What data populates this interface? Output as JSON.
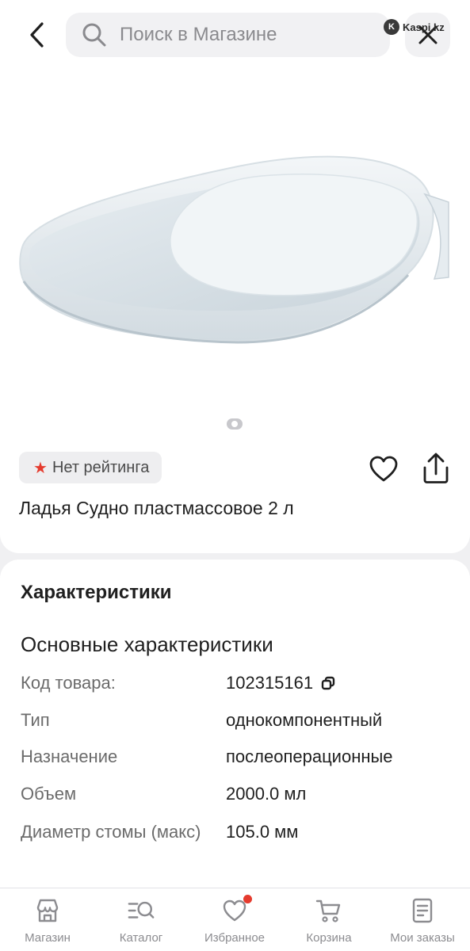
{
  "header": {
    "search_placeholder": "Поиск в Магазине",
    "watermark_text": "Kaspi.kz"
  },
  "product": {
    "image_alt": "white plastic bedpan",
    "gallery_count": 1,
    "rating_text": "Нет рейтинга",
    "title": "Ладья Судно пластмассовое 2 л"
  },
  "specs": {
    "heading": "Характеристики",
    "group_title": "Основные характеристики",
    "rows": [
      {
        "label": "Код товара:",
        "value": "102315161"
      },
      {
        "label": "Тип",
        "value": "однокомпонентный"
      },
      {
        "label": "Назначение",
        "value": "послеоперационные"
      },
      {
        "label": "Объем",
        "value": "2000.0 мл"
      },
      {
        "label": "Диаметр стомы (макс)",
        "value": "105.0 мм"
      }
    ]
  },
  "nav": {
    "items": [
      {
        "label": "Магазин",
        "icon": "store-icon"
      },
      {
        "label": "Каталог",
        "icon": "catalog-search-icon"
      },
      {
        "label": "Избранное",
        "icon": "heart-icon"
      },
      {
        "label": "Корзина",
        "icon": "cart-icon"
      },
      {
        "label": "Мои заказы",
        "icon": "orders-icon"
      }
    ]
  },
  "colors": {
    "accent_red": "#e53b2e",
    "text_primary": "#1f1f1f",
    "text_secondary": "#6b6b6b",
    "nav_label": "#8c8c90",
    "search_bg": "#f1f1f3",
    "page_bg": "#f0f0f2"
  }
}
